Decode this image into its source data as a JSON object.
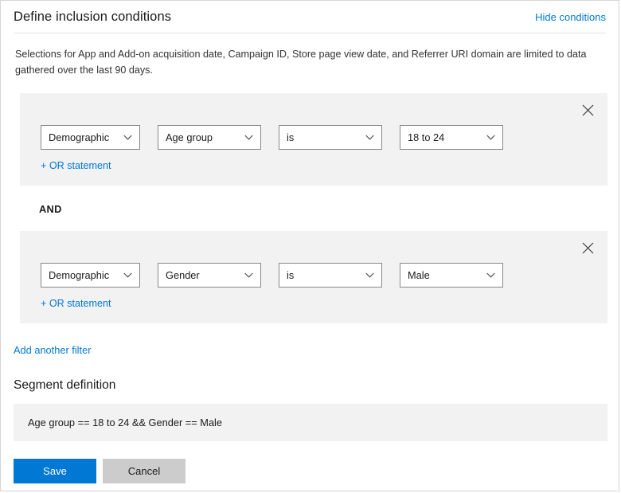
{
  "header": {
    "title": "Define inclusion conditions",
    "hide_conditions_label": "Hide conditions"
  },
  "description": "Selections for App and Add-on acquisition date, Campaign ID, Store page view date, and Referrer URI domain are limited to data gathered over the last 90 days.",
  "conditions": {
    "and_label": "AND",
    "or_statement_label": "+ OR statement",
    "close_icon": "close-icon",
    "chevron_icon": "chevron-down-icon",
    "blocks": [
      {
        "category": "Demographic",
        "field": "Age group",
        "operator": "is",
        "value": "18 to 24"
      },
      {
        "category": "Demographic",
        "field": "Gender",
        "operator": "is",
        "value": "Male"
      }
    ]
  },
  "add_filter_label": "Add another filter",
  "segment": {
    "title": "Segment definition",
    "definition": "Age group == 18 to 24 && Gender == Male"
  },
  "footer": {
    "save_label": "Save",
    "cancel_label": "Cancel"
  },
  "colors": {
    "accent": "#0078d4",
    "link": "#0078d4",
    "block_background": "#f2f2f2",
    "panel_border": "#d6d6d6",
    "cancel_background": "#cccccc"
  }
}
